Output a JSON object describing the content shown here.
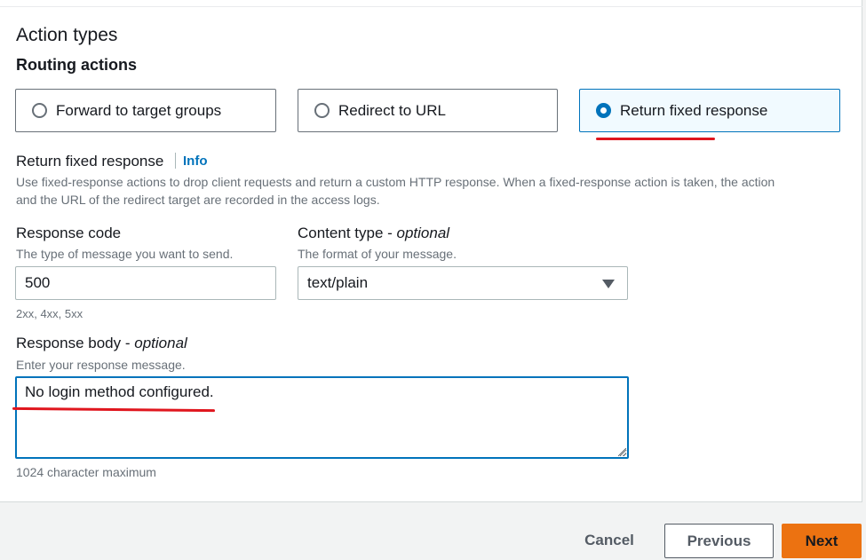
{
  "section": {
    "title": "Action types",
    "subtitle": "Routing actions"
  },
  "routing_options": [
    {
      "label": "Forward to target groups",
      "selected": false
    },
    {
      "label": "Redirect to URL",
      "selected": false
    },
    {
      "label": "Return fixed response",
      "selected": true
    }
  ],
  "fixed_response": {
    "label": "Return fixed response",
    "info_link": "Info",
    "description_line1": "Use fixed-response actions to drop client requests and return a custom HTTP response. When a fixed-response action is taken, the action",
    "description_line2": "and the URL of the redirect target are recorded in the access logs."
  },
  "response_code": {
    "label": "Response code",
    "description": "The type of message you want to send.",
    "value": "500",
    "constraint": "2xx, 4xx, 5xx"
  },
  "content_type": {
    "label": "Content type - ",
    "optional": "optional",
    "description": "The format of your message.",
    "value": "text/plain"
  },
  "response_body": {
    "label": "Response body - ",
    "optional": "optional",
    "description": "Enter your response message.",
    "value": "No login method configured.",
    "constraint": "1024 character maximum"
  },
  "footer": {
    "cancel_label": "Cancel",
    "previous_label": "Previous",
    "next_label": "Next"
  },
  "colors": {
    "accent": "#0073bb",
    "primary_button": "#ec7211",
    "annotation": "#e0161e"
  }
}
